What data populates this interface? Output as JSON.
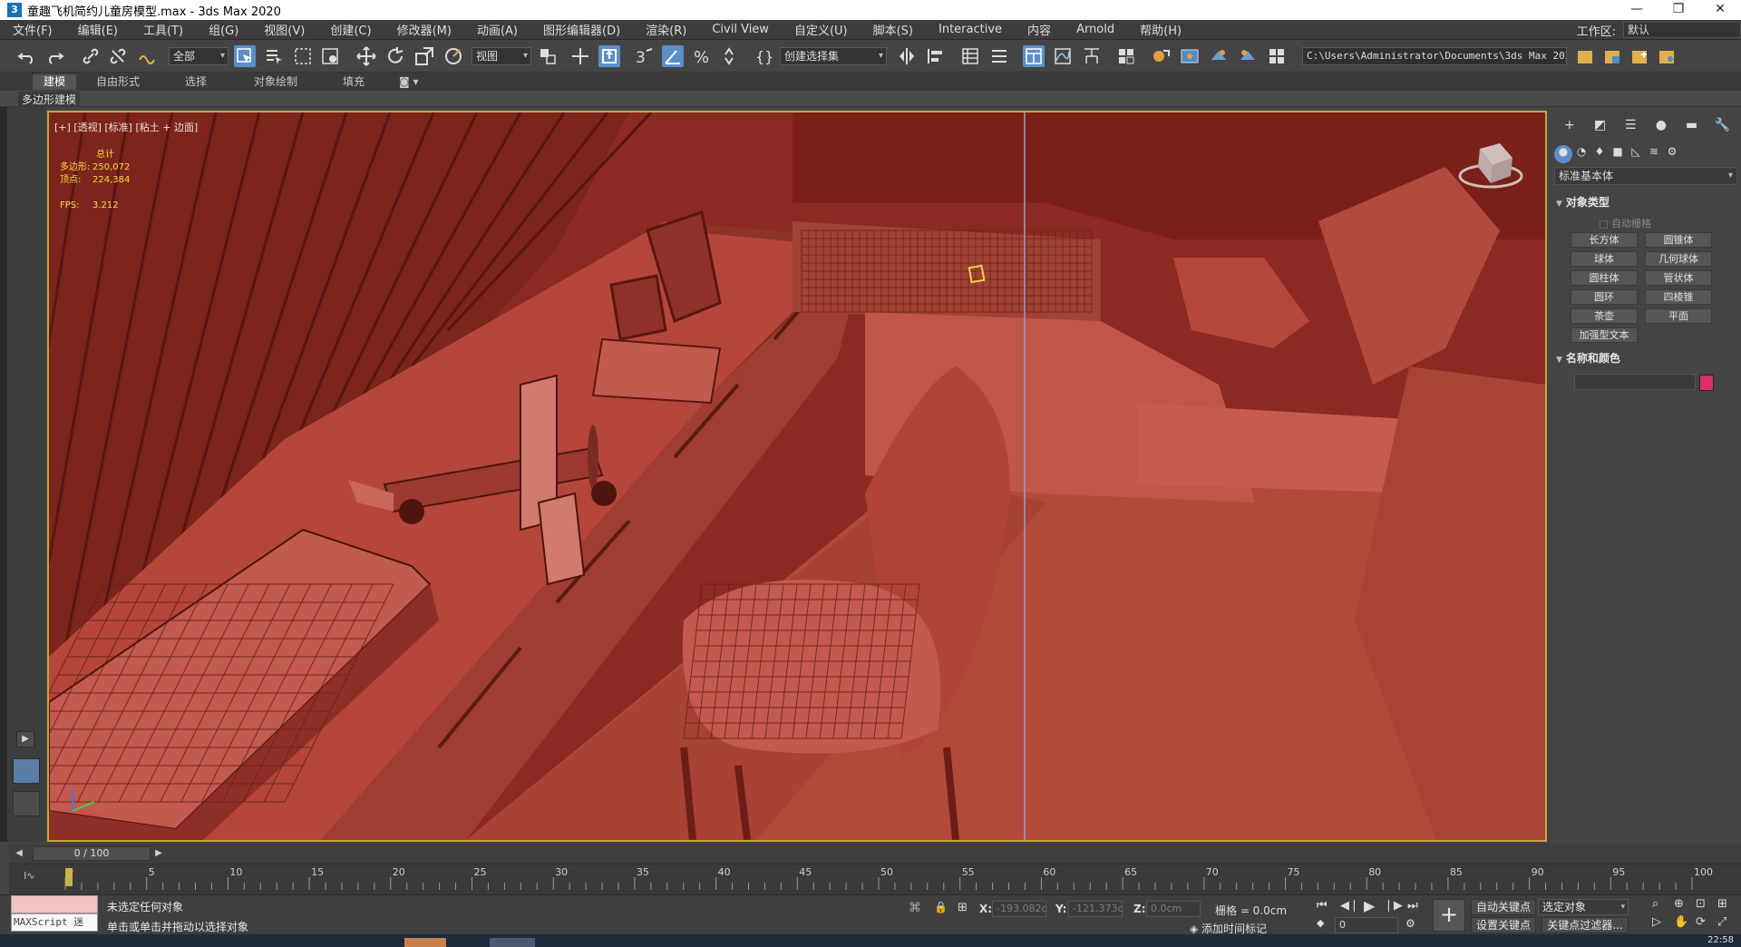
{
  "window": {
    "title": "童趣飞机简约儿童房模型.max - 3ds Max 2020",
    "controls": [
      "—",
      "❐",
      "✕"
    ]
  },
  "menu": {
    "items": [
      "文件(F)",
      "编辑(E)",
      "工具(T)",
      "组(G)",
      "视图(V)",
      "创建(C)",
      "修改器(M)",
      "动画(A)",
      "图形编辑器(D)",
      "渲染(R)",
      "Civil View",
      "自定义(U)",
      "脚本(S)",
      "Interactive",
      "内容",
      "Arnold",
      "帮助(H)"
    ],
    "workspace_label": "工作区:",
    "workspace_value": "默认"
  },
  "toolbar": {
    "selection_filter": "全部",
    "ref_coord": "视图",
    "named_selection": "创建选择集",
    "project_path": "C:\\Users\\Administrator\\Documents\\3ds Max 2020"
  },
  "ribbon": {
    "tabs": [
      "建模",
      "自由形式",
      "选择",
      "对象绘制",
      "填充"
    ],
    "active_tab": "建模",
    "sub_label": "多边形建模"
  },
  "viewport": {
    "label": "[+] [透视] [标准] [粘土 + 边面]",
    "stats": {
      "total_label": "总计",
      "polys_label": "多边形:",
      "polys_value": "250,072",
      "verts_label": "顶点:",
      "verts_value": "224,384",
      "fps_label": "FPS:",
      "fps_value": "3.212"
    },
    "bg_color": "#8a2a20"
  },
  "command_panel": {
    "category_dropdown": "标准基本体",
    "object_type_label": "对象类型",
    "autogrid_label": "自动栅格",
    "object_buttons": [
      "长方体",
      "圆锥体",
      "球体",
      "几何球体",
      "圆柱体",
      "管状体",
      "圆环",
      "四棱锥",
      "茶壶",
      "平面",
      "加强型文本"
    ],
    "name_color_label": "名称和颜色",
    "object_color": "#d92f6a"
  },
  "timeline": {
    "frame_display": "0 / 100",
    "tick_labels": [
      "0",
      "5",
      "10",
      "15",
      "20",
      "25",
      "30",
      "35",
      "40",
      "45",
      "50",
      "55",
      "60",
      "65",
      "70",
      "75",
      "80",
      "85",
      "90",
      "95",
      "100"
    ]
  },
  "status": {
    "maxscript_label": "MAXScript 迷",
    "selection_msg": "未选定任何对象",
    "prompt_msg": "单击或单击并拖动以选择对象",
    "x_label": "X:",
    "x_value": "-193.082c",
    "y_label": "Y:",
    "y_value": "-121.373c",
    "z_label": "Z:",
    "z_value": "0.0cm",
    "grid_label": "栅格 = 0.0cm",
    "add_time_tag": "添加时间标记",
    "auto_key": "自动关键点",
    "set_key": "设置关键点",
    "key_target": "选定对象",
    "key_filters": "关键点过滤器...",
    "frame_spinner": "0"
  },
  "taskbar": {
    "clock": "22:58"
  }
}
